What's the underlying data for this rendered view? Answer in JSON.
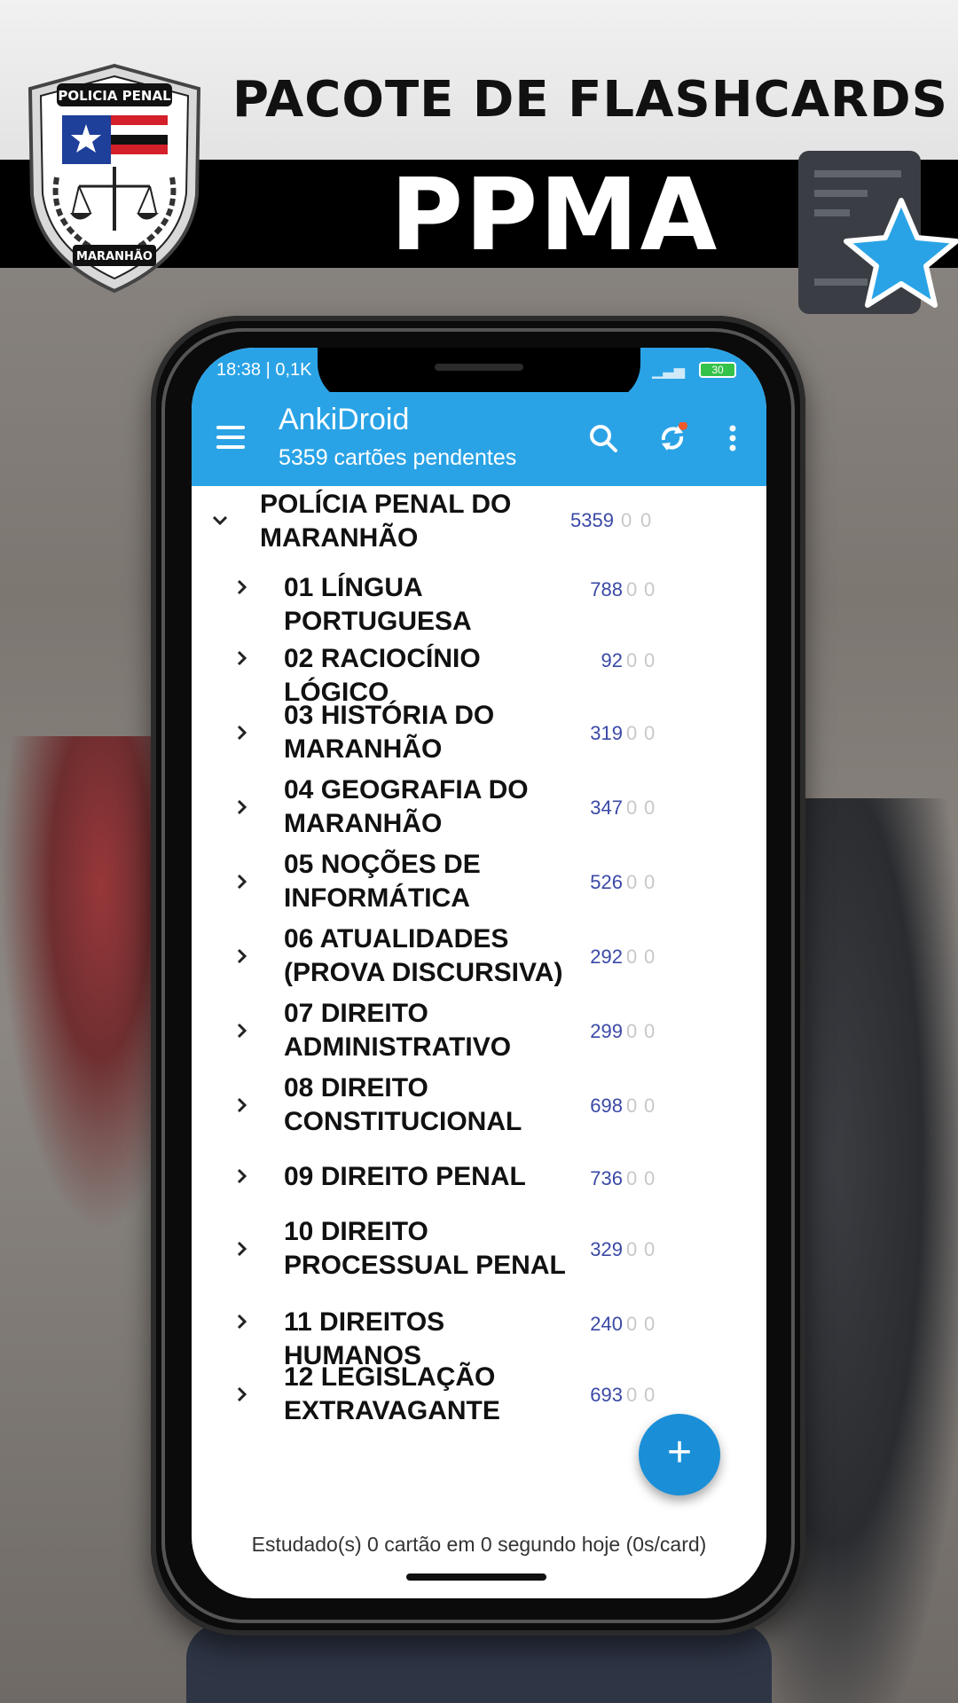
{
  "banner": {
    "title": "PACOTE DE FLASHCARDS",
    "subtitle": "PPMA",
    "badge_top_text": "POLICIA PENAL",
    "badge_bottom_text": "MARANHÃO"
  },
  "statusbar": {
    "time": "18:38 | 0,1K",
    "battery": "30"
  },
  "appbar": {
    "title": "AnkiDroid",
    "subtitle": "5359 cartões pendentes",
    "icons": [
      "menu-icon",
      "search-icon",
      "sync-icon",
      "more-vert-icon"
    ],
    "accent_color": "#2aa3e6",
    "sync_badge_color": "#f05a28"
  },
  "decks": [
    {
      "name": "POLÍCIA PENAL DO MARANHÃO",
      "due": "5359",
      "new": "0",
      "learn": "0",
      "expanded": true
    },
    {
      "name": "01 LÍNGUA PORTUGUESA",
      "due": "788",
      "new": "0",
      "learn": "0"
    },
    {
      "name": "02 RACIOCÍNIO LÓGICO",
      "due": "92",
      "new": "0",
      "learn": "0"
    },
    {
      "name": "03 HISTÓRIA DO MARANHÃO",
      "due": "319",
      "new": "0",
      "learn": "0"
    },
    {
      "name": "04 GEOGRAFIA DO MARANHÃO",
      "due": "347",
      "new": "0",
      "learn": "0"
    },
    {
      "name": "05 NOÇÕES DE INFORMÁTICA",
      "due": "526",
      "new": "0",
      "learn": "0"
    },
    {
      "name": "06 ATUALIDADES (PROVA DISCURSIVA)",
      "due": "292",
      "new": "0",
      "learn": "0"
    },
    {
      "name": "07 DIREITO ADMINISTRATIVO",
      "due": "299",
      "new": "0",
      "learn": "0"
    },
    {
      "name": "08 DIREITO CONSTITUCIONAL",
      "due": "698",
      "new": "0",
      "learn": "0"
    },
    {
      "name": "09 DIREITO PENAL",
      "due": "736",
      "new": "0",
      "learn": "0"
    },
    {
      "name": "10 DIREITO PROCESSUAL PENAL",
      "due": "329",
      "new": "0",
      "learn": "0"
    },
    {
      "name": "11 DIREITOS HUMANOS",
      "due": "240",
      "new": "0",
      "learn": "0"
    },
    {
      "name": "12 LEGISLAÇÃO EXTRAVAGANTE",
      "due": "693",
      "new": "0",
      "learn": "0"
    }
  ],
  "fab": {
    "label": "+"
  },
  "footer": {
    "studied_text": "Estudado(s) 0 cartão em 0 segundo hoje (0s/card)"
  }
}
